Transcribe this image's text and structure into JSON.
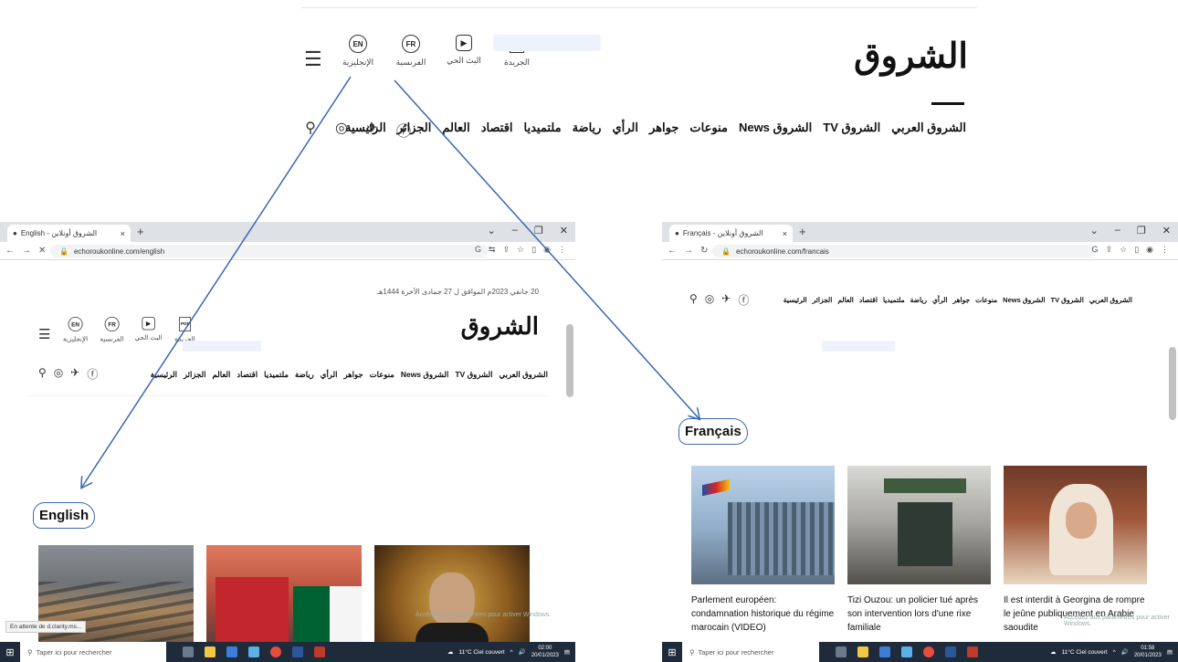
{
  "top": {
    "logo": "الشروق",
    "editions": [
      {
        "icon": "EN",
        "label": "الإنجليزية"
      },
      {
        "icon": "FR",
        "label": "الفرنسية"
      },
      {
        "icon": "▶",
        "label": "البث الحي"
      },
      {
        "icon": "PDF",
        "label": "الجريدة"
      }
    ],
    "nav": [
      "الرئيسية",
      "الجزائر",
      "العالم",
      "اقتصاد",
      "ملتميديا",
      "رياضة",
      "الرأي",
      "جواهر",
      "منوعات",
      "الشروق News",
      "الشروق TV",
      "الشروق العربي"
    ]
  },
  "left_window": {
    "tab_title": "English - الشروق أونلاين",
    "url": "echoroukonline.com/english",
    "date": "20 جانفي 2023م الموافق ل 27 جمادى الآخرة 1444هـ",
    "logo": "الشروق",
    "section_title": "English",
    "status_text": "En attente de d.clarity.ms...",
    "watermark": "Accédez aux paramètres pour activer Windows."
  },
  "right_window": {
    "tab_title": "Français - الشروق أونلاين",
    "url": "echoroukonline.com/francais",
    "section_title": "Français",
    "cards": [
      {
        "caption": "Parlement européen: condamnation historique du régime marocain (VIDEO)"
      },
      {
        "caption": "Tizi Ouzou: un policier tué après son intervention lors d'une rixe familiale"
      },
      {
        "caption": "Il est interdit à Georgina de rompre le jeûne publiquement en Arabie saoudite"
      }
    ],
    "watermark": "Accédez aux paramètres pour activer Windows."
  },
  "taskbar_left": {
    "search_placeholder": "Taper ici pour rechercher",
    "weather": "11°C Ciel couvert",
    "time": "02:00",
    "date": "20/01/2023"
  },
  "taskbar_right": {
    "search_placeholder": "Taper ici pour rechercher",
    "weather": "11°C Ciel couvert",
    "time": "01:58",
    "date": "20/01/2023"
  },
  "colors": {
    "annotation": "#3a67b5",
    "taskbar": "#1f2b3b"
  }
}
